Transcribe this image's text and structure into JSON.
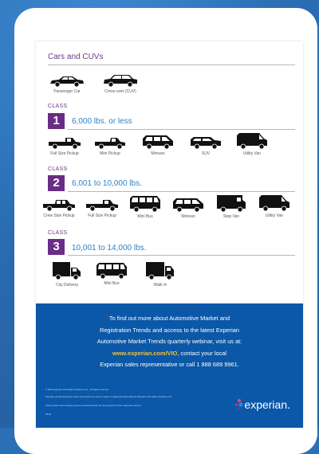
{
  "sections": {
    "cars": {
      "title": "Cars and CUVs",
      "vehicles": [
        {
          "label": "Passenger Car",
          "icon": "sedan-icon"
        },
        {
          "label": "Cross-over (CUV)",
          "icon": "cuv-icon"
        }
      ]
    },
    "class1": {
      "class_label": "CLASS",
      "number": "1",
      "weight": "6,000 lbs. or less",
      "vehicles": [
        {
          "label": "Full Size Pickup",
          "icon": "pickup-icon"
        },
        {
          "label": "Mini Pickup",
          "icon": "pickup-icon"
        },
        {
          "label": "Minivan",
          "icon": "minivan-icon"
        },
        {
          "label": "SUV",
          "icon": "suv-icon"
        },
        {
          "label": "Utility Van",
          "icon": "van-icon"
        }
      ]
    },
    "class2": {
      "class_label": "CLASS",
      "number": "2",
      "weight": "6,001 to 10,000 lbs.",
      "vehicles": [
        {
          "label": "Crew Size Pickup",
          "icon": "pickup-icon"
        },
        {
          "label": "Full Size Pickup",
          "icon": "pickup-icon"
        },
        {
          "label": "Mini Bus",
          "icon": "bus-icon"
        },
        {
          "label": "Minivan",
          "icon": "minivan-icon"
        },
        {
          "label": "Step Van",
          "icon": "van-icon"
        },
        {
          "label": "Utility Van",
          "icon": "van-icon"
        }
      ]
    },
    "class3": {
      "class_label": "CLASS",
      "number": "3",
      "weight": "10,001 to 14,000 lbs.",
      "vehicles": [
        {
          "label": "City Delivery",
          "icon": "truck-icon"
        },
        {
          "label": "Mini Bus",
          "icon": "bus-icon"
        },
        {
          "label": "Walk In",
          "icon": "truck-icon"
        }
      ]
    }
  },
  "footer": {
    "cta_line1": "To find out more about Automotive Market and",
    "cta_line2": "Registration Trends and access to the latest Experian",
    "cta_line3": "Automotive Market Trends quarterly webinar, visit us at:",
    "cta_url": "www.experian.com/VIO",
    "cta_line4_rest": ", contact your local",
    "cta_line5": "Experian sales representative or call 1 888 689 9961.",
    "legal1": "© 2019 Experian Information Solutions, Inc. • All rights reserved.",
    "legal2": "Experian and the Experian marks used herein are service marks or registered trademarks of Experian Information Solutions, Inc.",
    "legal3": "Other product and company names mentioned herein are the property of their respective owners.",
    "legal4": "03/19",
    "logo_text": "experian."
  },
  "colors": {
    "purple": "#6a2c86",
    "blue_text": "#2f82c8",
    "footer_blue": "#0b57a8",
    "url_yellow": "#f2c230"
  }
}
